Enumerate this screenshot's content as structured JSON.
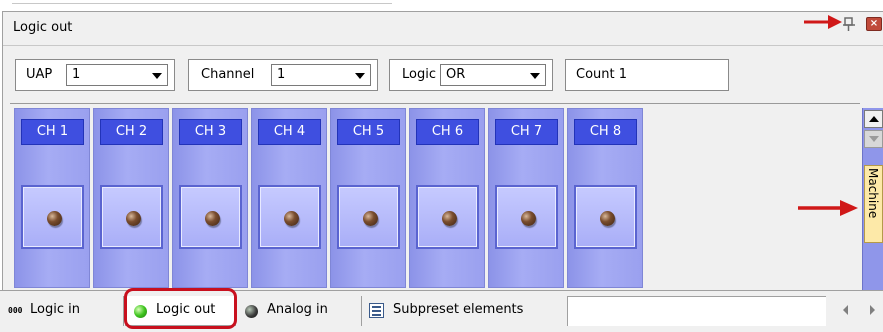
{
  "panel": {
    "title": "Logic out"
  },
  "toolbar": {
    "uap": {
      "label": "UAP",
      "value": "1"
    },
    "channel": {
      "label": "Channel",
      "value": "1"
    },
    "logic": {
      "label": "Logic",
      "value": "OR"
    },
    "count": {
      "text": "Count 1"
    }
  },
  "channels": [
    {
      "label": "CH 1"
    },
    {
      "label": "CH 2"
    },
    {
      "label": "CH 3"
    },
    {
      "label": "CH 4"
    },
    {
      "label": "CH 5"
    },
    {
      "label": "CH 6"
    },
    {
      "label": "CH 7"
    },
    {
      "label": "CH 8"
    }
  ],
  "side_tab": {
    "label": "Machine"
  },
  "tabs": [
    {
      "label": "Logic in",
      "icon": "bits-icon"
    },
    {
      "label": "Logic out",
      "icon": "green-dot-icon",
      "active": true
    },
    {
      "label": "Analog in",
      "icon": "dark-dot-icon"
    },
    {
      "label": "Subpreset elements",
      "icon": "list-icon"
    }
  ],
  "colors": {
    "channel_fill": "#a6acf4",
    "channel_head": "#3f4fe0",
    "highlight_ring": "#c8101e",
    "arrow": "#d01818",
    "side_tab": "#fde9a8"
  }
}
